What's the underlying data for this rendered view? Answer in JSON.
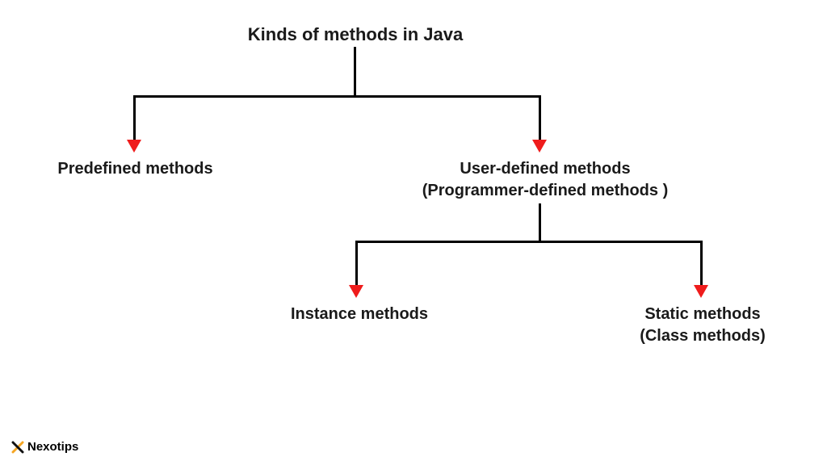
{
  "diagram": {
    "title": "Kinds of methods in Java",
    "level1": {
      "predefined": "Predefined methods",
      "userdefined_line1": "User-defined methods",
      "userdefined_line2": "(Programmer-defined methods )"
    },
    "level2": {
      "instance": "Instance methods",
      "static_line1": "Static methods",
      "static_line2": "(Class methods)"
    }
  },
  "brand": {
    "name": "Nexotips"
  }
}
